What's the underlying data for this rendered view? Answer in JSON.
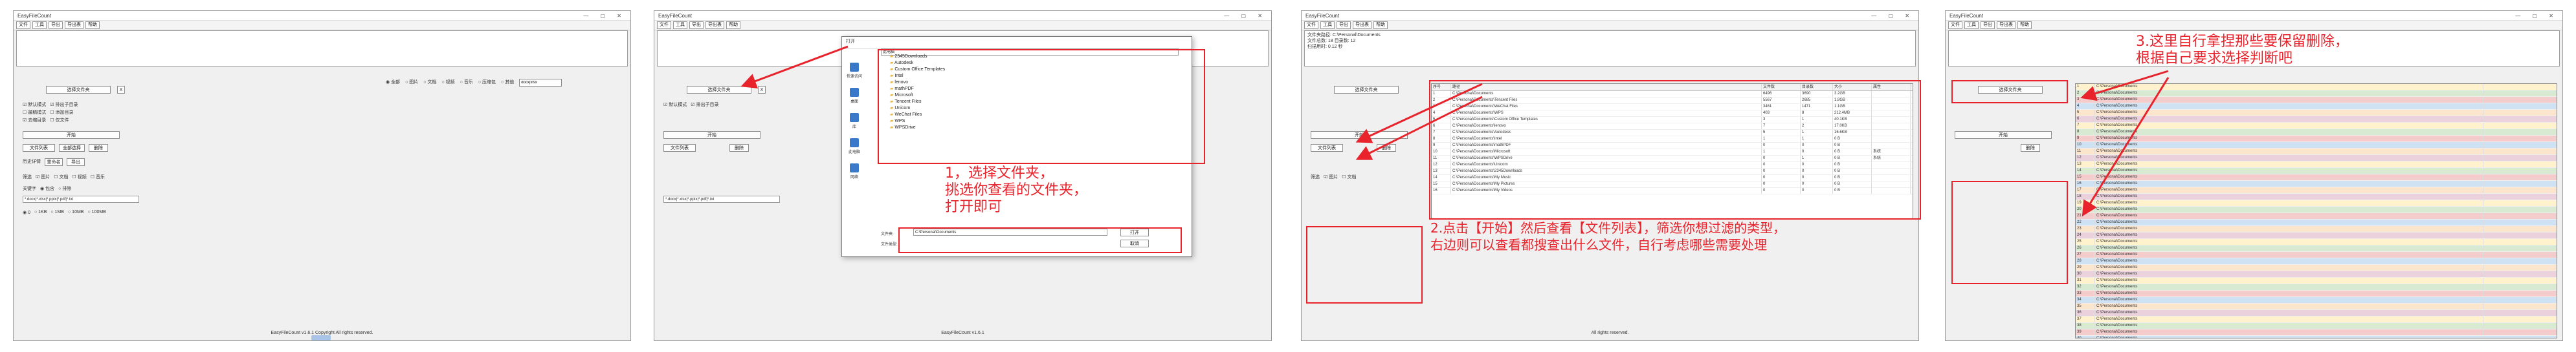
{
  "app": {
    "title": "EasyFileCount",
    "menu": [
      "文件",
      "工具",
      "导出",
      "导出表",
      "帮助"
    ],
    "footer": "EasyFileCount v1.6.1 Copyright All rights reserved.",
    "footer_short": "EasyFileCount v1.6.1",
    "footer_tail": "All rights reserved."
  },
  "controls": {
    "select_folder": "选择文件夹",
    "btn_x": "X",
    "rad_all": "全部",
    "rad_contains": "包含",
    "rad_exclude": "排除",
    "opt1": "默认模式",
    "opt2": "排出子目录",
    "opt3": "最精模式",
    "opt4": "添加目录",
    "opt5": "去缩目录",
    "opt6": "仅文件",
    "start": "开始",
    "file_list": "文件列表",
    "all_select": "全部选择",
    "delete": "删除",
    "history_search": "历史详情",
    "rename": "重命名",
    "export": "导出",
    "filter_label": "筛选",
    "search_placeholder": "docx|xlsx",
    "type_row": [
      "全部",
      "图片",
      "文档",
      "视频",
      "音乐",
      "压缩包",
      "其他"
    ],
    "size_row": [
      "0",
      "1KB",
      "1MB",
      "10MB",
      "100MB"
    ],
    "kw_label": "关键字",
    "pattern_value": "*.docx|*.xlsx|*.pptx|*.pdf|*.txt"
  },
  "panel2": {
    "note": "1，选择文件夹，\n挑选你查看的文件夹，\n打开即可",
    "dialog_title": "打开",
    "path_value": "此电脑",
    "folders": [
      "2345Downloads",
      "Autodesk",
      "Custom Office Templates",
      "Intel",
      "lenovo",
      "mathPDF",
      "Microsoft",
      "Tencent Files",
      "Unicorn",
      "WeChat Files",
      "WPS",
      "WPSDrive"
    ],
    "nav": [
      "快速访问",
      "桌面",
      "库",
      "此电脑",
      "网络"
    ],
    "file_name_label": "文件夹:",
    "file_name_value": "C:\\Personal\\Documents",
    "type_label": "文件类型:",
    "open_btn": "打开",
    "cancel_btn": "取消"
  },
  "panel3": {
    "note": "2.点击【开始】然后查看【文件列表】，筛选你想过滤的类型，\n右边则可以查看都搜查出什么文件，自行考虑哪些需要处理",
    "info_lines": [
      "文件夹路径: C:\\Personal\\Documents",
      "文件总数: 18 目录数: 12",
      "扫描用时: 0.12 秒"
    ],
    "headers": [
      "序号",
      "路径",
      "文件数",
      "目录数",
      "大小",
      "属性"
    ],
    "rows": [
      [
        "1",
        "C:\\Personal\\Documents",
        "6496",
        "3690",
        "3.2GB",
        ""
      ],
      [
        "2",
        "C:\\Personal\\Documents\\Tencent Files",
        "5567",
        "2685",
        "1.8GB",
        ""
      ],
      [
        "3",
        "C:\\Personal\\Documents\\WeChat Files",
        "3461",
        "1471",
        "1.1GB",
        ""
      ],
      [
        "4",
        "C:\\Personal\\Documents\\WPS",
        "403",
        "8",
        "212.4MB",
        ""
      ],
      [
        "5",
        "C:\\Personal\\Documents\\Custom Office Templates",
        "3",
        "1",
        "40.1KB",
        ""
      ],
      [
        "6",
        "C:\\Personal\\Documents\\lenovo",
        "7",
        "2",
        "17.0KB",
        ""
      ],
      [
        "7",
        "C:\\Personal\\Documents\\Autodesk",
        "5",
        "1",
        "16.6KB",
        ""
      ],
      [
        "8",
        "C:\\Personal\\Documents\\Intel",
        "1",
        "1",
        "0 B",
        ""
      ],
      [
        "9",
        "C:\\Personal\\Documents\\mathPDF",
        "0",
        "0",
        "0 B",
        ""
      ],
      [
        "10",
        "C:\\Personal\\Documents\\Microsoft",
        "1",
        "0",
        "0 B",
        "系统"
      ],
      [
        "11",
        "C:\\Personal\\Documents\\WPSDrive",
        "0",
        "1",
        "0 B",
        "系统"
      ],
      [
        "12",
        "C:\\Personal\\Documents\\Unicorn",
        "0",
        "0",
        "0 B",
        ""
      ],
      [
        "13",
        "C:\\Personal\\Documents\\2345Downloads",
        "0",
        "0",
        "0 B",
        ""
      ],
      [
        "14",
        "C:\\Personal\\Documents\\My Music",
        "0",
        "0",
        "0 B",
        ""
      ],
      [
        "15",
        "C:\\Personal\\Documents\\My Pictures",
        "0",
        "0",
        "0 B",
        ""
      ],
      [
        "16",
        "C:\\Personal\\Documents\\My Videos",
        "0",
        "0",
        "0 B",
        ""
      ]
    ]
  },
  "panel4": {
    "note": "3.这里自行拿捏那些要保留删除，\n根据自己要求选择判断吧",
    "path_text": "C:\\Personal\\Documents"
  }
}
